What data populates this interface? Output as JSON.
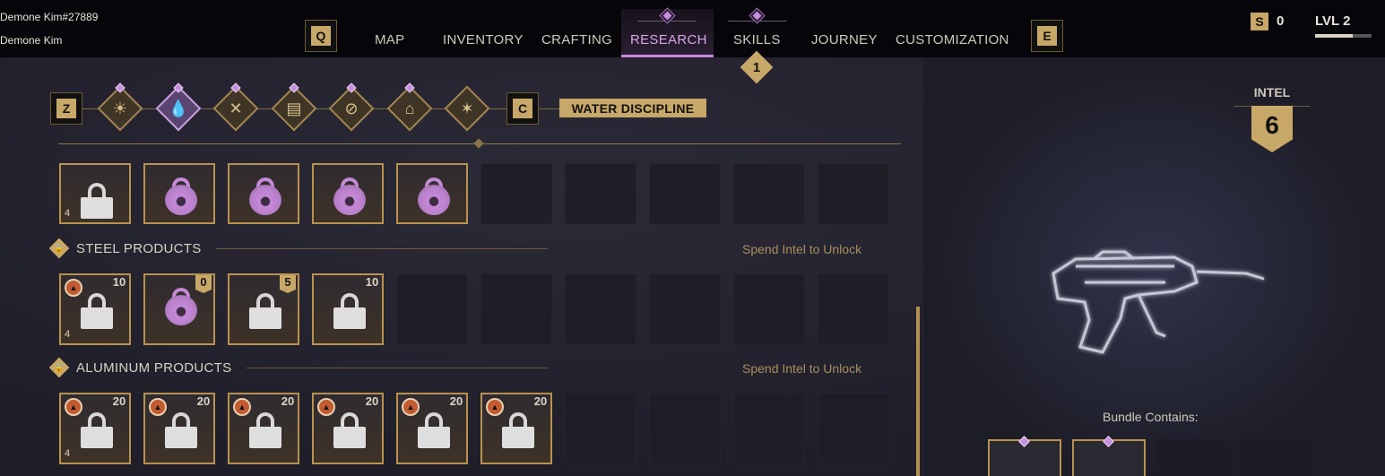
{
  "player": {
    "tag": "Demone Kim#27889",
    "name": "Demone Kim"
  },
  "nav": {
    "prev_key": "Q",
    "next_key": "E",
    "items": [
      {
        "label": "MAP"
      },
      {
        "label": "INVENTORY"
      },
      {
        "label": "CRAFTING"
      },
      {
        "label": "RESEARCH",
        "active": true
      },
      {
        "label": "SKILLS",
        "badge": "1"
      },
      {
        "label": "JOURNEY"
      },
      {
        "label": "CUSTOMIZATION"
      }
    ]
  },
  "status": {
    "currency_icon": "S",
    "currency": "0",
    "level": "LVL 2",
    "level_progress": 0.66
  },
  "disciplines": {
    "prev_key": "Z",
    "next_key": "C",
    "selected_label": "WATER DISCIPLINE",
    "icons": [
      "sun-icon",
      "water-drop-icon",
      "crossed-tools-icon",
      "bricks-icon",
      "no-sign-icon",
      "backpack-icon",
      "cluster-icon"
    ]
  },
  "sections": [
    {
      "title": "",
      "tiles": [
        {
          "type": "lock",
          "tier": "4"
        },
        {
          "type": "orb"
        },
        {
          "type": "orb"
        },
        {
          "type": "orb"
        },
        {
          "type": "orb"
        }
      ]
    },
    {
      "title": "STEEL PRODUCTS",
      "hint": "Spend Intel to Unlock",
      "tiles": [
        {
          "type": "lock",
          "count": "10",
          "warn": true,
          "tier": "4"
        },
        {
          "type": "orb",
          "count": "0",
          "flag": true
        },
        {
          "type": "lock",
          "count": "5",
          "flag": true
        },
        {
          "type": "lock",
          "count": "10"
        }
      ]
    },
    {
      "title": "ALUMINUM PRODUCTS",
      "hint": "Spend Intel to Unlock",
      "tiles": [
        {
          "type": "lock",
          "count": "20",
          "warn": true,
          "tier": "4"
        },
        {
          "type": "lock",
          "count": "20",
          "warn": true
        },
        {
          "type": "lock",
          "count": "20",
          "warn": true
        },
        {
          "type": "lock",
          "count": "20",
          "warn": true
        },
        {
          "type": "lock",
          "count": "20",
          "warn": true
        },
        {
          "type": "lock",
          "count": "20",
          "warn": true
        }
      ]
    }
  ],
  "intel": {
    "label": "INTEL",
    "value": "6"
  },
  "bundle": {
    "label": "Bundle Contains:"
  }
}
